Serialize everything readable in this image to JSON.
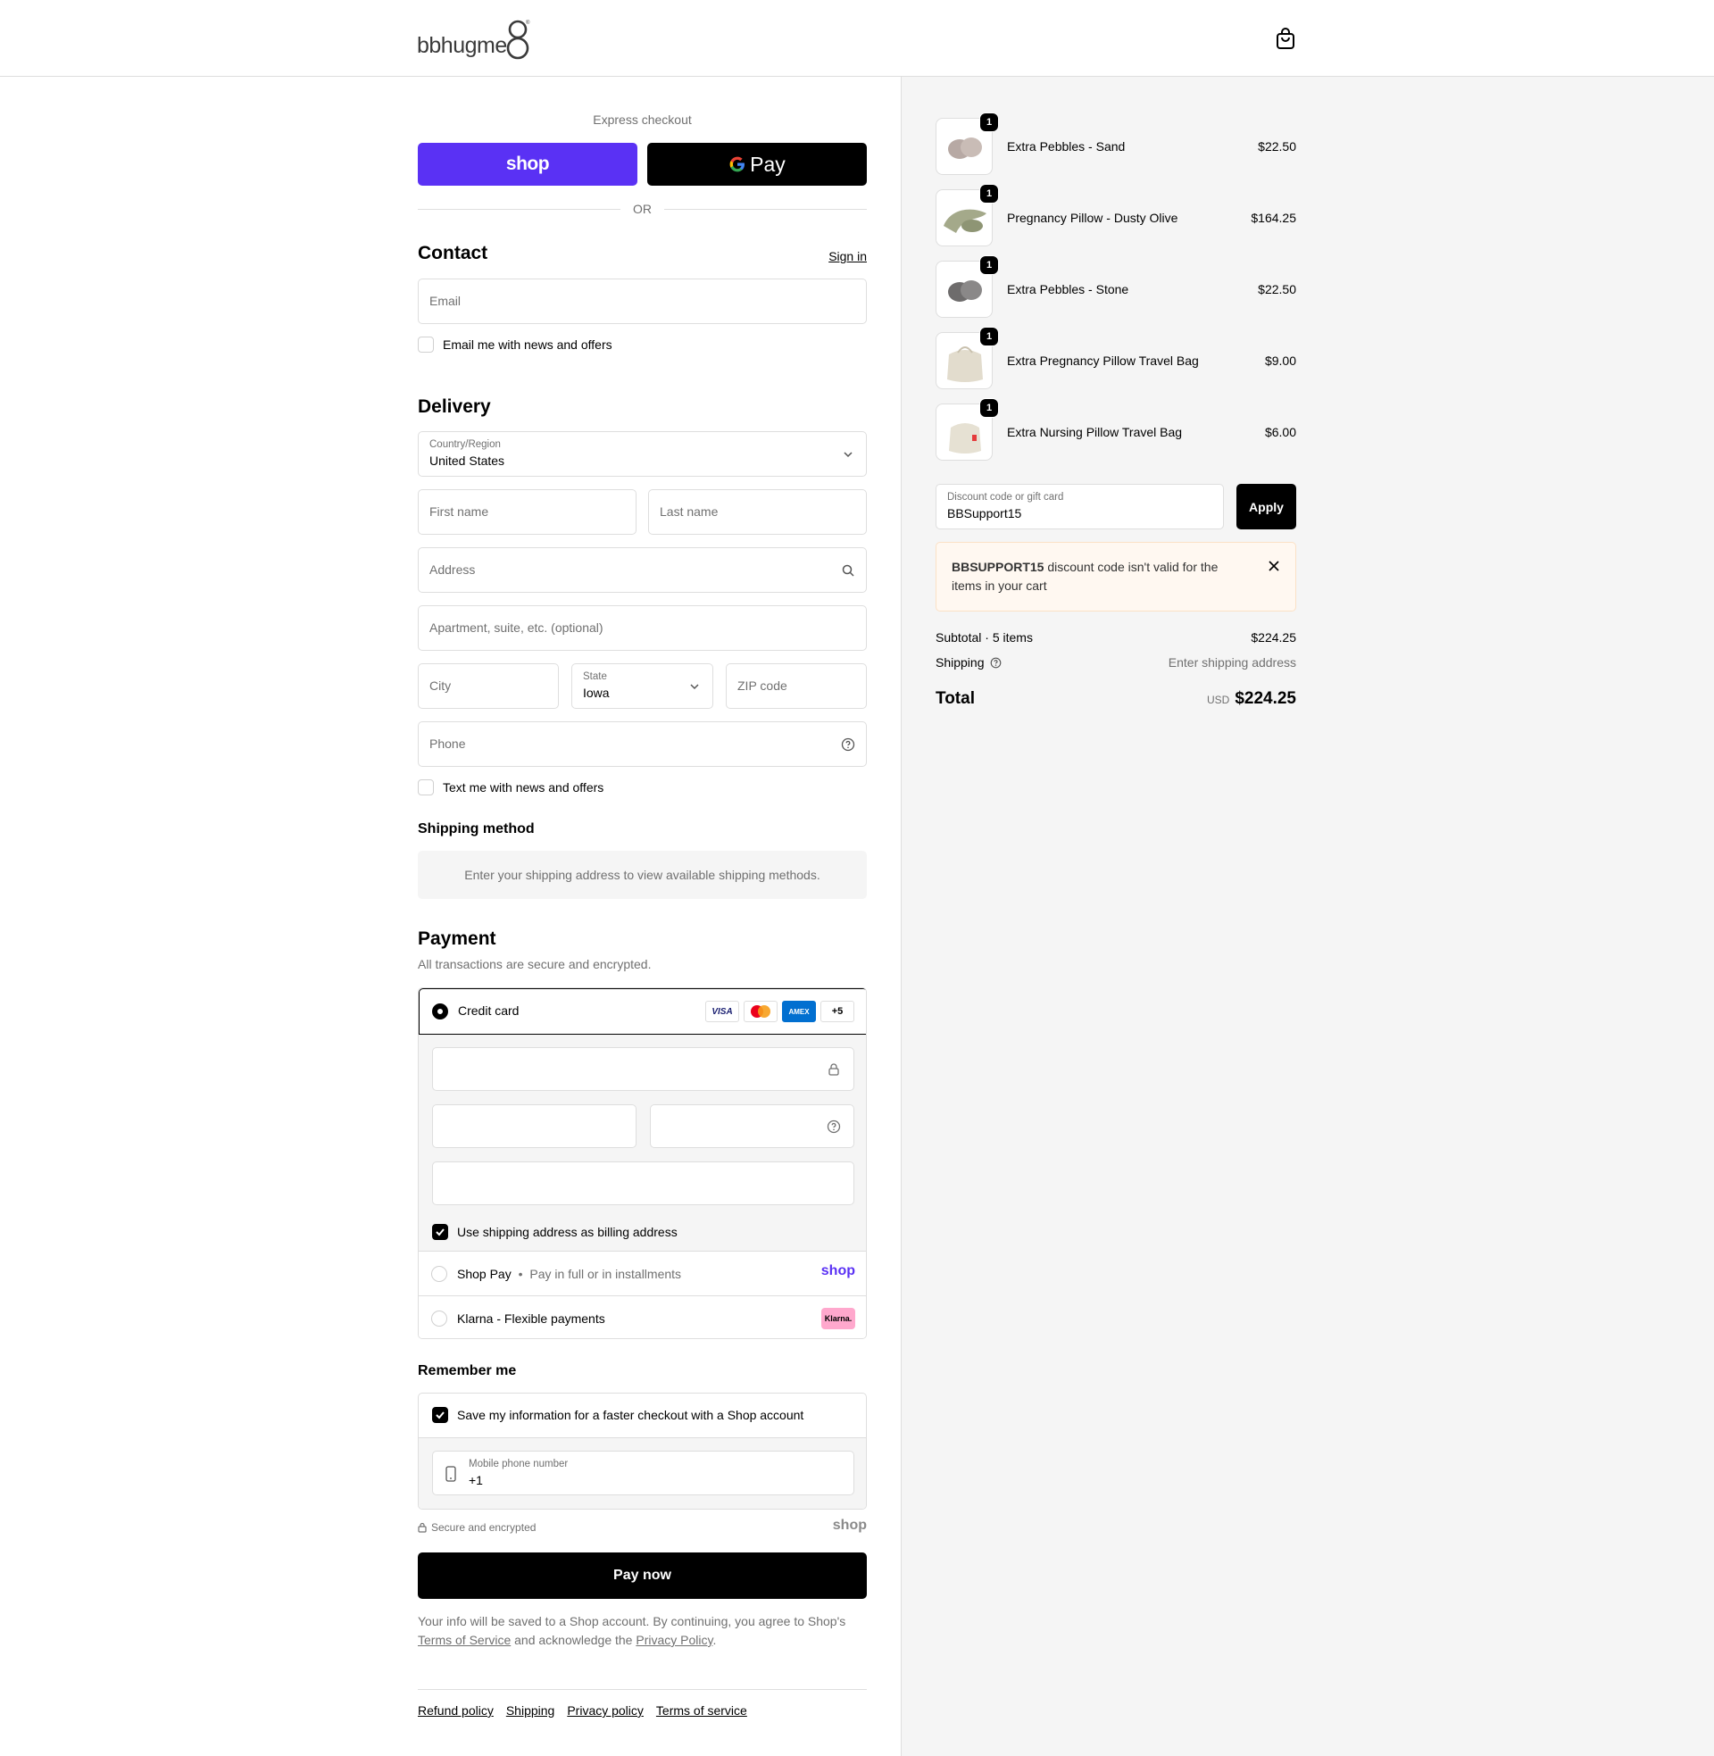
{
  "header": {
    "logo_text": "bbhugme",
    "cart_icon": "shopping-bag-icon"
  },
  "express": {
    "title": "Express checkout",
    "shop_label": "shop",
    "gpay_label": "Pay",
    "or_label": "OR"
  },
  "contact": {
    "heading": "Contact",
    "sign_in": "Sign in",
    "email_placeholder": "Email",
    "email_news_label": "Email me with news and offers"
  },
  "delivery": {
    "heading": "Delivery",
    "country_label": "Country/Region",
    "country_value": "United States",
    "first_name_placeholder": "First name",
    "last_name_placeholder": "Last name",
    "address_placeholder": "Address",
    "apartment_placeholder": "Apartment, suite, etc. (optional)",
    "city_placeholder": "City",
    "state_label": "State",
    "state_value": "Iowa",
    "zip_placeholder": "ZIP code",
    "phone_placeholder": "Phone",
    "text_news_label": "Text me with news and offers"
  },
  "shipping_method": {
    "heading": "Shipping method",
    "message": "Enter your shipping address to view available shipping methods."
  },
  "payment": {
    "heading": "Payment",
    "subtitle": "All transactions are secure and encrypted.",
    "credit_card_label": "Credit card",
    "card_badges": [
      "VISA",
      "MC",
      "AMEX",
      "+5"
    ],
    "billing_same_label": "Use shipping address as billing address",
    "shop_pay_label": "Shop Pay",
    "shop_pay_sub": "Pay in full or in installments",
    "shop_pay_logo": "shop",
    "klarna_label": "Klarna - Flexible payments",
    "klarna_logo": "Klarna."
  },
  "remember": {
    "heading": "Remember me",
    "save_label": "Save my information for a faster checkout with a Shop account",
    "phone_label": "Mobile phone number",
    "phone_value": "+1"
  },
  "secure": {
    "label": "Secure and encrypted",
    "logo": "shop"
  },
  "pay_now": "Pay now",
  "legal": {
    "text1": "Your info will be saved to a Shop account. By continuing, you agree to Shop's ",
    "tos": "Terms of Service",
    "text2": " and acknowledge the ",
    "privacy": "Privacy Policy",
    "text3": "."
  },
  "footer": {
    "links": [
      "Refund policy",
      "Shipping",
      "Privacy policy",
      "Terms of service"
    ]
  },
  "cart": {
    "items": [
      {
        "name": "Extra Pebbles - Sand",
        "price": "$22.50",
        "qty": "1"
      },
      {
        "name": "Pregnancy Pillow - Dusty Olive",
        "price": "$164.25",
        "qty": "1"
      },
      {
        "name": "Extra Pebbles - Stone",
        "price": "$22.50",
        "qty": "1"
      },
      {
        "name": "Extra Pregnancy Pillow Travel Bag",
        "price": "$9.00",
        "qty": "1"
      },
      {
        "name": "Extra Nursing Pillow Travel Bag",
        "price": "$6.00",
        "qty": "1"
      }
    ],
    "discount_label": "Discount code or gift card",
    "discount_value": "BBSupport15",
    "apply_label": "Apply",
    "warning_code": "BBSUPPORT15",
    "warning_text": " discount code isn't valid for the items in your cart",
    "subtotal_label": "Subtotal · 5 items",
    "subtotal_value": "$224.25",
    "shipping_label": "Shipping",
    "shipping_value": "Enter shipping address",
    "total_label": "Total",
    "currency": "USD",
    "total_value": "$224.25"
  }
}
